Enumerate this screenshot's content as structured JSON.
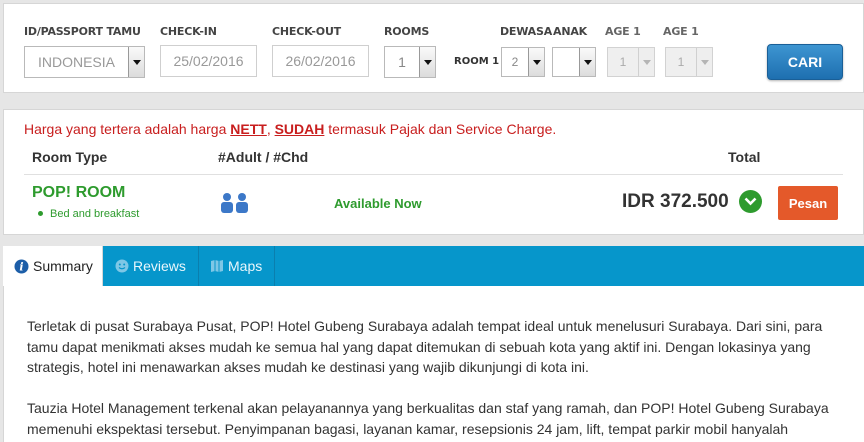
{
  "search": {
    "passport_label": "ID/PASSPORT TAMU",
    "passport_value": "INDONESIA",
    "checkin_label": "CHECK-IN",
    "checkin_value": "25/02/2016",
    "checkout_label": "CHECK-OUT",
    "checkout_value": "26/02/2016",
    "rooms_label": "ROOMS",
    "rooms_value": "1",
    "room1_label": "ROOM 1",
    "adult_label": "DEWASA",
    "adult_value": "2",
    "child_label": "ANAK",
    "child_value": "",
    "age1_label": "AGE 1",
    "age1_value": "1",
    "age2_label": "AGE 1",
    "age2_value": "1",
    "search_button": "CARI"
  },
  "results": {
    "notice_before": "Harga yang tertera adalah harga ",
    "notice_nett": "NETT",
    "notice_comma": ", ",
    "notice_sudah": "SUDAH",
    "notice_after": " termasuk Pajak dan Service Charge.",
    "col_room_type": "Room Type",
    "col_adult_child": "#Adult / #Chd",
    "col_total": "Total",
    "room": {
      "name": "POP! ROOM",
      "meal": "Bed and breakfast",
      "availability": "Available Now",
      "price": "IDR 372.500",
      "book_button": "Pesan"
    }
  },
  "tabs": [
    {
      "label": "Summary",
      "icon": "info-icon"
    },
    {
      "label": "Reviews",
      "icon": "smiley-icon"
    },
    {
      "label": "Maps",
      "icon": "map-icon"
    }
  ],
  "summary": {
    "paragraph1": "Terletak di pusat Surabaya Pusat, POP! Hotel Gubeng Surabaya adalah tempat ideal untuk menelusuri Surabaya. Dari sini, para tamu dapat menikmati akses mudah ke semua hal yang dapat ditemukan di sebuah kota yang aktif ini. Dengan lokasinya yang strategis, hotel ini menawarkan akses mudah ke destinasi yang wajib dikunjungi di kota ini.",
    "paragraph2": "Tauzia Hotel Management terkenal akan pelayanannya yang berkualitas dan staf yang ramah, dan POP! Hotel Gubeng Surabaya memenuhi ekspektasi tersebut. Penyimpanan bagasi, layanan kamar, resepsionis 24 jam, lift, tempat parkir mobil hanyalah"
  },
  "colors": {
    "accent_blue": "#0696cb",
    "button_blue": "#1e6fb0",
    "green": "#2e9b2e",
    "orange": "#e4592a",
    "red": "#c81e1e"
  }
}
